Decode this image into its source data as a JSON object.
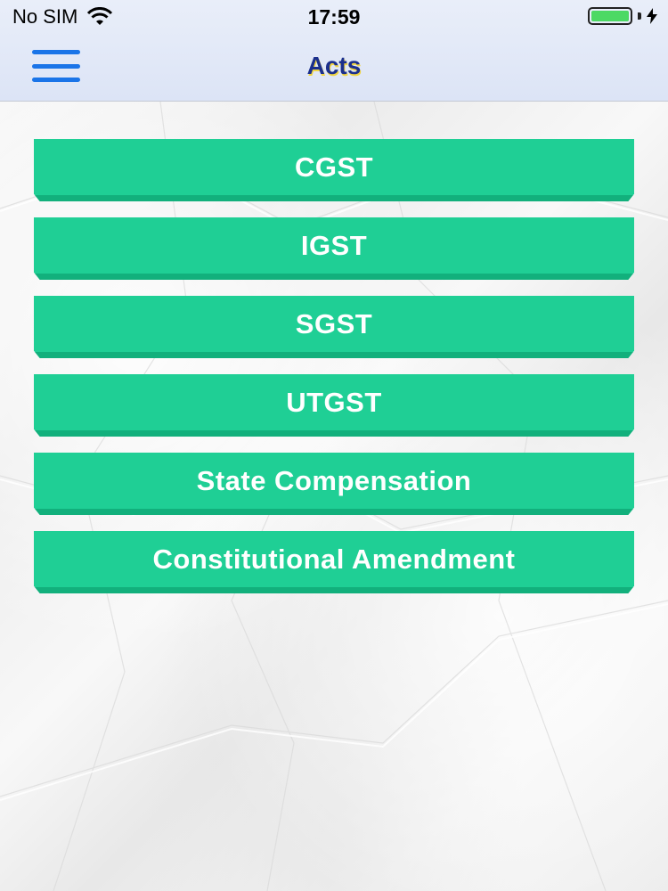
{
  "status_bar": {
    "carrier": "No SIM",
    "time": "17:59",
    "battery_level": 1.0,
    "battery_color": "#4cd964",
    "icons": [
      "wifi-icon",
      "battery-icon",
      "charging-bolt-icon"
    ]
  },
  "nav": {
    "title": "Acts",
    "menu_icon": "hamburger-menu-icon",
    "title_color": "#1b2f8c"
  },
  "acts": [
    {
      "label": "CGST"
    },
    {
      "label": "IGST"
    },
    {
      "label": "SGST"
    },
    {
      "label": "UTGST"
    },
    {
      "label": "State Compensation"
    },
    {
      "label": "Constitutional Amendment"
    }
  ],
  "colors": {
    "button": "#1fcf95",
    "menu_icon": "#1a74e8"
  }
}
